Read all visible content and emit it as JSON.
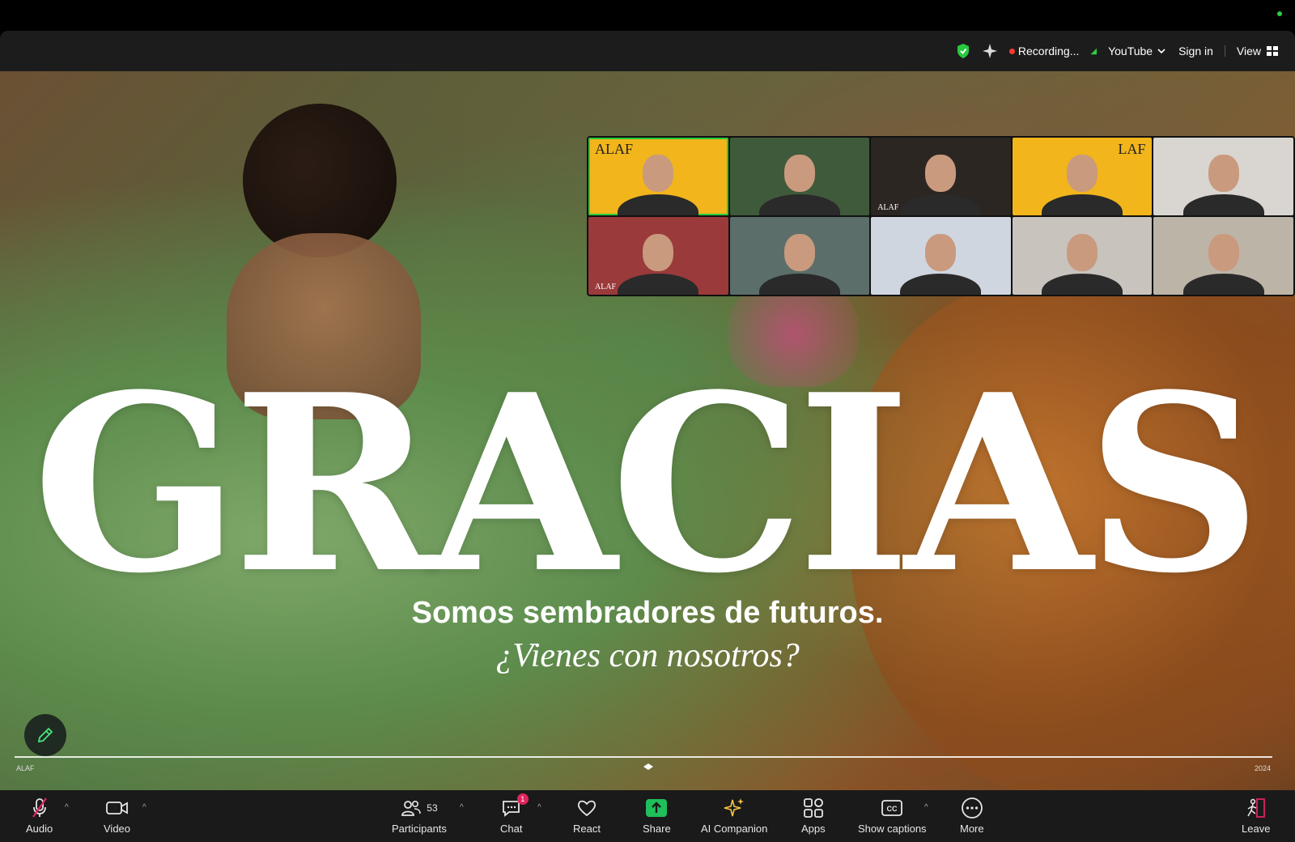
{
  "header": {
    "recording_label": "Recording...",
    "stream_label": "YouTube",
    "sign_in_label": "Sign in",
    "view_label": "View"
  },
  "slide": {
    "title": "GRACIAS",
    "subtitle": "Somos sembradores de futuros.",
    "question": "¿Vienes con nosotros?",
    "left_mark": "ALAF",
    "right_mark": "2024"
  },
  "gallery": {
    "participants": [
      {
        "tag": "ALAF",
        "active": true,
        "bg": "#f2b51b"
      },
      {
        "tag": "",
        "active": false,
        "bg": "#3f5a3a"
      },
      {
        "tag": "ALAF",
        "active": false,
        "bg": "#2c2623"
      },
      {
        "tag": "LAF",
        "active": false,
        "bg": "#f2b51b"
      },
      {
        "tag": "",
        "active": false,
        "bg": "#d9d6d1"
      },
      {
        "tag": "ALAF",
        "active": false,
        "bg": "#9a3a3a"
      },
      {
        "tag": "",
        "active": false,
        "bg": "#5b6e6a"
      },
      {
        "tag": "",
        "active": false,
        "bg": "#cfd6df"
      },
      {
        "tag": "",
        "active": false,
        "bg": "#c8c3bc"
      },
      {
        "tag": "",
        "active": false,
        "bg": "#bdb4a8"
      }
    ]
  },
  "toolbar": {
    "audio": "Audio",
    "video": "Video",
    "participants": "Participants",
    "participant_count": "53",
    "chat": "Chat",
    "chat_badge": "1",
    "react": "React",
    "share": "Share",
    "ai_companion": "AI Companion",
    "apps": "Apps",
    "captions": "Show captions",
    "more": "More",
    "leave": "Leave"
  },
  "colors": {
    "accent_green": "#27c93f",
    "record_red": "#ff3b30",
    "leave_red": "#e0245e"
  }
}
